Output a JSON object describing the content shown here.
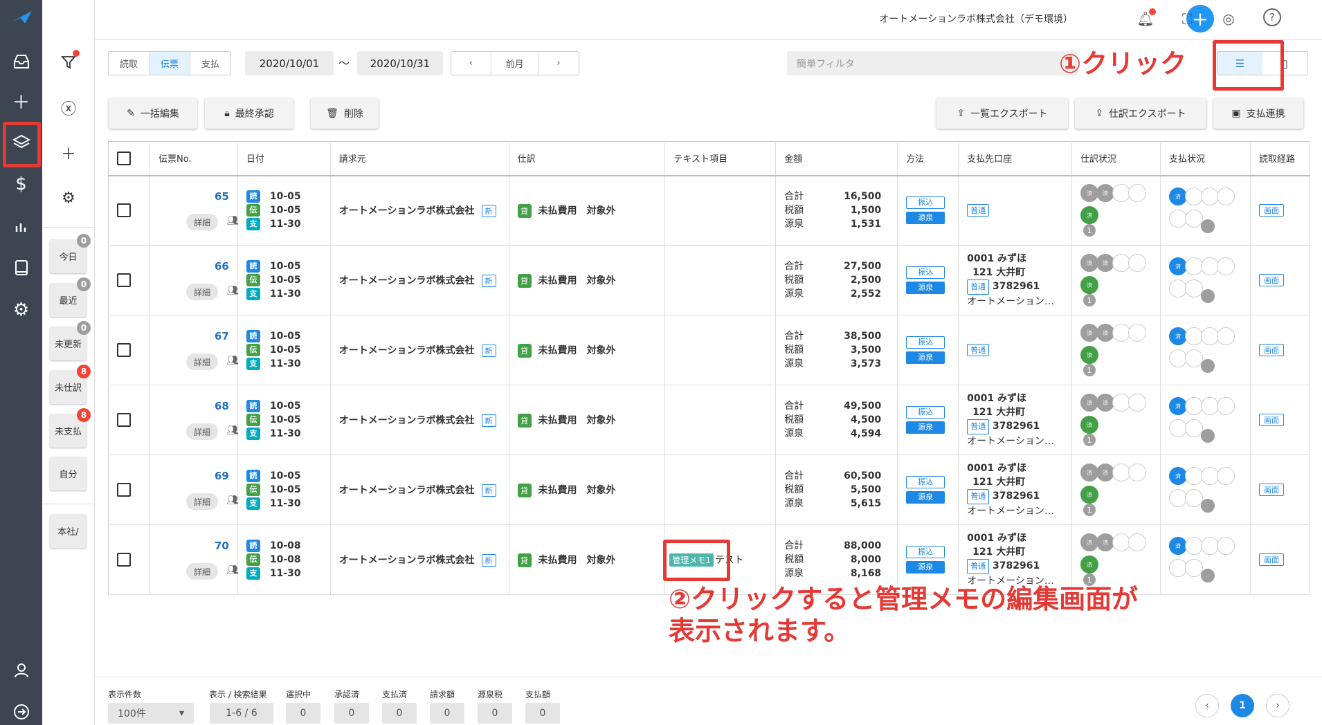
{
  "header": {
    "company": "オートメーションラボ株式会社（デモ環境）"
  },
  "sidebar2": {
    "buttons": [
      {
        "label": "今日",
        "count": "0",
        "color": "grey"
      },
      {
        "label": "最近",
        "count": "0",
        "color": "grey"
      },
      {
        "label": "未更新",
        "count": "0",
        "color": "grey"
      },
      {
        "label": "未仕訳",
        "count": "8",
        "color": "red"
      },
      {
        "label": "未支払",
        "count": "8",
        "color": "red"
      },
      {
        "label": "自分",
        "count": "",
        "color": ""
      },
      {
        "label": "本社/",
        "count": "",
        "color": ""
      }
    ]
  },
  "toolbar": {
    "tabs": [
      "読取",
      "伝票",
      "支払"
    ],
    "date_from": "2020/10/01",
    "tilde": "〜",
    "date_to": "2020/10/31",
    "prev_label": "前月",
    "filter_placeholder": "簡単フィルタ",
    "bulk_edit": "一括編集",
    "final_approve": "最終承認",
    "delete": "削除",
    "list_export": "一覧エクスポート",
    "journal_export": "仕訳エクスポート",
    "payment_link": "支払連携"
  },
  "table": {
    "headers": [
      "伝票No.",
      "日付",
      "請求元",
      "仕訳",
      "テキスト項目",
      "金額",
      "方法",
      "支払先口座",
      "仕訳状況",
      "支払状況",
      "読取経路"
    ],
    "detail_label": "詳細",
    "new_label": "新",
    "kasi_label": "貸",
    "journal_text": "未払費用　対象外",
    "amount_labels": [
      "合計",
      "税額",
      "源泉"
    ],
    "method_labels": [
      "振込",
      "源泉"
    ],
    "route_label": "画面",
    "circle_label": "済",
    "date_tags": [
      "読",
      "伝",
      "支"
    ],
    "rows": [
      {
        "no": "65",
        "d1": "10-05",
        "d2": "10-05",
        "d3": "11-30",
        "vendor": "オートメーションラボ株式会社",
        "text": "",
        "memo": "",
        "total": "16,500",
        "tax": "1,500",
        "gensen": "1,531",
        "acct": "",
        "acct2": "",
        "acct_num": "",
        "acct_name": ""
      },
      {
        "no": "66",
        "d1": "10-05",
        "d2": "10-05",
        "d3": "11-30",
        "vendor": "オートメーションラボ株式会社",
        "text": "",
        "memo": "",
        "total": "27,500",
        "tax": "2,500",
        "gensen": "2,552",
        "acct": "0001 みずほ",
        "acct2": "121 大井町",
        "acct_num": "3782961",
        "acct_name": "オートメーション…"
      },
      {
        "no": "67",
        "d1": "10-05",
        "d2": "10-05",
        "d3": "11-30",
        "vendor": "オートメーションラボ株式会社",
        "text": "",
        "memo": "",
        "total": "38,500",
        "tax": "3,500",
        "gensen": "3,573",
        "acct": "",
        "acct2": "",
        "acct_num": "",
        "acct_name": ""
      },
      {
        "no": "68",
        "d1": "10-05",
        "d2": "10-05",
        "d3": "11-30",
        "vendor": "オートメーションラボ株式会社",
        "text": "",
        "memo": "",
        "total": "49,500",
        "tax": "4,500",
        "gensen": "4,594",
        "acct": "0001 みずほ",
        "acct2": "121 大井町",
        "acct_num": "3782961",
        "acct_name": "オートメーション…"
      },
      {
        "no": "69",
        "d1": "10-05",
        "d2": "10-05",
        "d3": "11-30",
        "vendor": "オートメーションラボ株式会社",
        "text": "",
        "memo": "",
        "total": "60,500",
        "tax": "5,500",
        "gensen": "5,615",
        "acct": "0001 みずほ",
        "acct2": "121 大井町",
        "acct_num": "3782961",
        "acct_name": "オートメーション…"
      },
      {
        "no": "70",
        "d1": "10-08",
        "d2": "10-08",
        "d3": "11-30",
        "vendor": "オートメーションラボ株式会社",
        "text": "テスト",
        "memo": "管理メモ1",
        "total": "88,000",
        "tax": "8,000",
        "gensen": "8,168",
        "acct": "0001 みずほ",
        "acct2": "121 大井町",
        "acct_num": "3782961",
        "acct_name": "オートメーション…"
      }
    ],
    "futsu_label": "普通",
    "gensen_num": "1"
  },
  "annotations": {
    "step1": "①クリック",
    "step2_line1": "②クリックすると管理メモの編集画面が",
    "step2_line2": "表示されます。"
  },
  "bottom": {
    "per_page_label": "表示件数",
    "per_page_value": "100件",
    "result_label": "表示 / 検索結果",
    "result_value": "1-6 / 6",
    "stats": [
      {
        "label": "選択中",
        "value": "0"
      },
      {
        "label": "承認済",
        "value": "0"
      },
      {
        "label": "支払済",
        "value": "0"
      },
      {
        "label": "請求額",
        "value": "0"
      },
      {
        "label": "源泉税",
        "value": "0"
      },
      {
        "label": "支払額",
        "value": "0"
      }
    ],
    "page": "1"
  }
}
